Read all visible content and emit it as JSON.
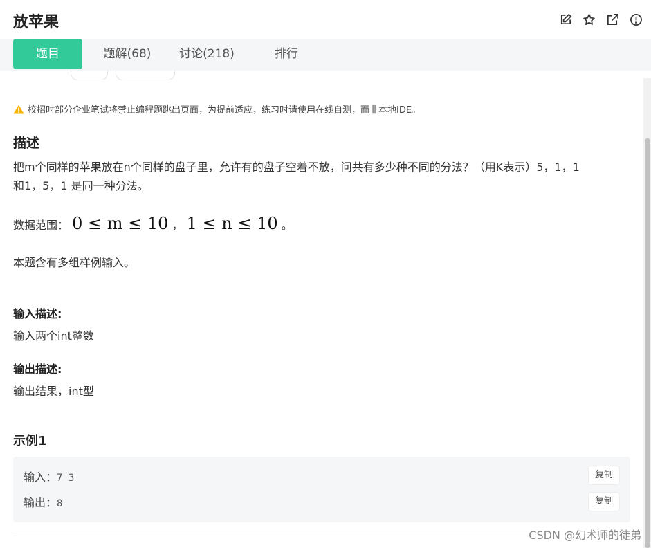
{
  "header": {
    "title": "放苹果",
    "icons": [
      "edit-icon",
      "star-icon",
      "external-link-icon",
      "report-icon"
    ]
  },
  "tabs": [
    {
      "label": "题目",
      "active": true
    },
    {
      "label": "题解(68)",
      "active": false
    },
    {
      "label": "讨论(218)",
      "active": false
    },
    {
      "label": "排行",
      "active": false
    }
  ],
  "notice": "校招时部分企业笔试将禁止编程题跳出页面，为提前适应，练习时请使用在线自测，而非本地IDE。",
  "description": {
    "heading": "描述",
    "line1": "把m个同样的苹果放在n个同样的盘子里，允许有的盘子空着不放，问共有多少种不同的分法？（用K表示）5，1，1",
    "line2": "和1，5，1 是同一种分法。",
    "range_label": "数据范围：",
    "range_m": "0 ≤ m ≤ 10",
    "range_sep": "，",
    "range_n": "1 ≤ n ≤ 10",
    "range_end": "。",
    "multi": "本题含有多组样例输入。"
  },
  "input_desc": {
    "heading": "输入描述:",
    "text": "输入两个int整数"
  },
  "output_desc": {
    "heading": "输出描述:",
    "text": "输出结果，int型"
  },
  "example": {
    "heading": "示例1",
    "input_label": "输入：",
    "input_value": "7 3",
    "output_label": "输出：",
    "output_value": "8",
    "copy_label": "复制"
  },
  "watermark": "CSDN @幻术师的徒弟",
  "colors": {
    "accent": "#32ca99",
    "warning": "#f5b400"
  }
}
